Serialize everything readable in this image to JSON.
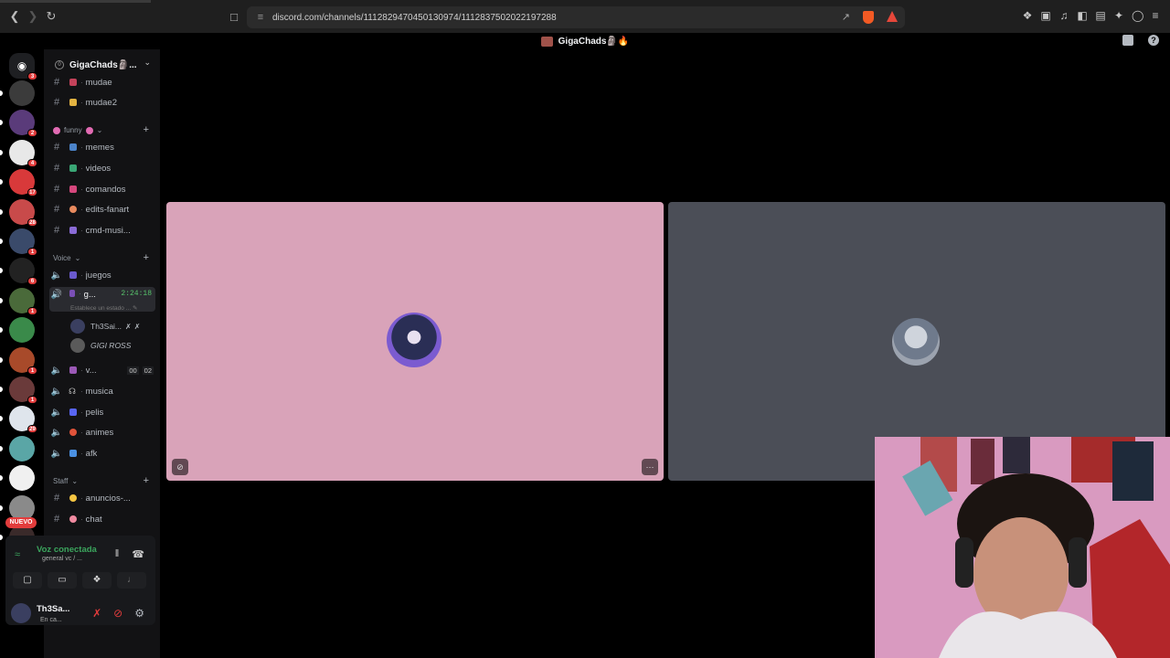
{
  "browser": {
    "url": "discord.com/channels/1112829470450130974/1112837502022197288",
    "alert_count": "1"
  },
  "window": {
    "title": "GigaChads🗿🔥"
  },
  "servers": [
    {
      "badge": ""
    },
    {
      "badge": "2"
    },
    {
      "badge": "4"
    },
    {
      "badge": "17"
    },
    {
      "badge": "28"
    },
    {
      "badge": "1"
    },
    {
      "badge": "6"
    },
    {
      "badge": "1"
    },
    {
      "badge": ""
    },
    {
      "badge": "1"
    },
    {
      "badge": "1"
    },
    {
      "badge": "29"
    },
    {
      "badge": ""
    },
    {
      "badge": ""
    },
    {
      "badge": ""
    },
    {
      "badge": ""
    }
  ],
  "rail": {
    "home_badge": "3",
    "nuevo": "NUEVO"
  },
  "guild": {
    "name": "GigaChads🗿...",
    "boost": "0"
  },
  "channels": {
    "mudae": "mudae",
    "mudae2": "mudae2",
    "cat_funny": "funny",
    "memes": "memes",
    "videos": "videos",
    "comandos": "comandos",
    "edits": "edits-fanart",
    "cmd": "cmd-musi...",
    "cat_voice": "Voice",
    "juegos": "juegos",
    "general": "g...",
    "general_time": "2:24:18",
    "status_hint": "Establece un estado ...",
    "member1": "Th3Sai...",
    "member2": "GIGI ROSS",
    "v": "v...",
    "v_count1": "00",
    "v_count2": "02",
    "musica": "musica",
    "pelis": "pelis",
    "animes": "animes",
    "afk": "afk",
    "cat_staff": "Staff",
    "anuncios": "anuncios-...",
    "chat": "chat"
  },
  "voice_panel": {
    "title": "Voz conectada",
    "sub": "general vc / ..."
  },
  "user": {
    "name": "Th3Sa...",
    "status": "En ca..."
  },
  "colors": {
    "pink_tile": "#d9a3b9",
    "grey_tile": "#4b4e57",
    "connected": "#3ba55d"
  }
}
